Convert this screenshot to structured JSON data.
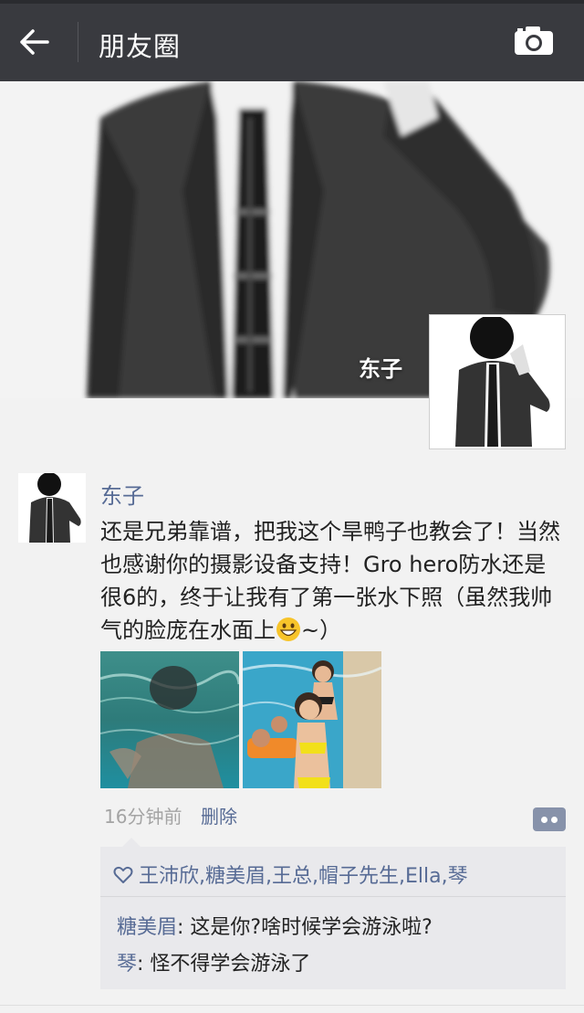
{
  "header": {
    "title": "朋友圈"
  },
  "cover": {
    "user_name": "东子"
  },
  "post": {
    "author": "东子",
    "text_parts": [
      "还是兄弟靠谱，把我这个旱鸭子也教会了！当然也感谢你的摄影设备支持！Gro hero防水还是很6的，终于让我有了第一张水下照（虽然我帅气的脸庞在水面上",
      "~）"
    ],
    "emoji": "grinning-face-emoji",
    "time": "16分钟前",
    "delete_label": "删除",
    "likes": "王沛欣,糖美眉,王总,帽子先生,Ella,琴",
    "comments": [
      {
        "author": "糖美眉",
        "text": ": 这是你?啥时候学会游泳啦?"
      },
      {
        "author": "琴",
        "text": ": 怪不得学会游泳了"
      }
    ]
  },
  "colors": {
    "header_bg": "#393a3f",
    "link": "#576b95",
    "page_bg": "#f2f2f2"
  }
}
